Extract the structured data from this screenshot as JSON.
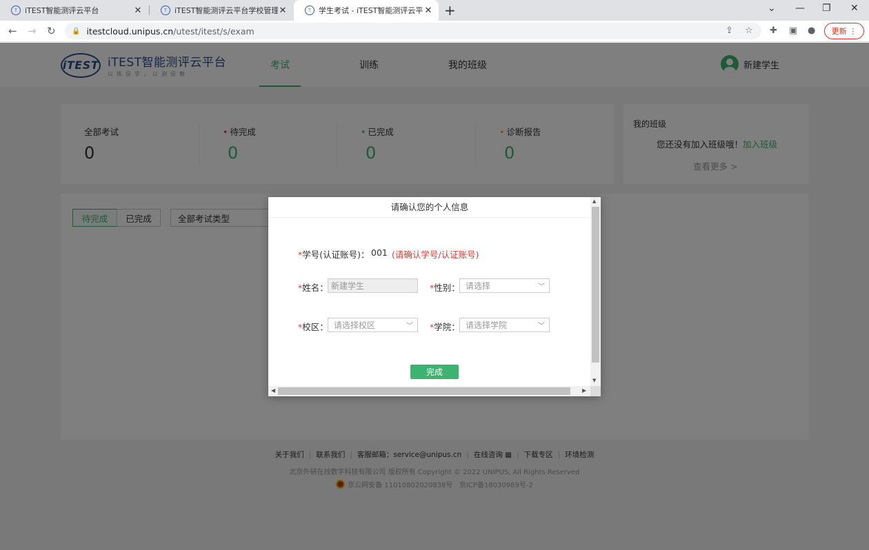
{
  "browser": {
    "tabs": [
      {
        "title": "iTEST智能测评云平台"
      },
      {
        "title": "iTEST智能测评云平台学校管理员"
      },
      {
        "title": "学生考试 - iTEST智能测评云平台"
      }
    ],
    "url_host": "itestcloud.unipus.cn",
    "url_path": "/utest/itest/s/exam",
    "update_label": "更新"
  },
  "header": {
    "logo_mark": "iTEST",
    "logo_title": "iTEST智能测评云平台",
    "logo_sub": "以练促学，以测促教",
    "nav": [
      "考试",
      "训练",
      "我的班级"
    ],
    "user_name": "新建学生"
  },
  "stats": [
    {
      "label": "全部考试",
      "value": "0"
    },
    {
      "label": "待完成",
      "value": "0"
    },
    {
      "label": "已完成",
      "value": "0"
    },
    {
      "label": "诊断报告",
      "value": "0"
    }
  ],
  "my_class": {
    "title": "我的班级",
    "message": "您还没有加入班级哦！",
    "join": "加入班级",
    "more": "查看更多 >"
  },
  "filters": {
    "pending": "待完成",
    "done": "已完成",
    "type": "全部考试类型"
  },
  "footer": {
    "links": [
      "关于我们",
      "联系我们",
      "客服邮箱：service@unipus.cn",
      "在线咨询",
      "下载专区",
      "环境检测"
    ],
    "copyright": "北京外研在线数字科技有限公司 版权所有 Copyright © 2022 UNIPUS, All Rights Reserved",
    "police": "京公网安备 11010802020838号",
    "icp": "京ICP备18030989号-2"
  },
  "modal": {
    "title": "请确认您的个人信息",
    "id_label": "学号(认证账号)：",
    "id_value": "001",
    "id_hint": "(请确认学号/认证账号)",
    "name_label": "姓名：",
    "name_value": "新建学生",
    "gender_label": "性别：",
    "gender_placeholder": "请选择",
    "campus_label": "校区：",
    "campus_placeholder": "请选择校区",
    "college_label": "学院：",
    "college_placeholder": "请选择学院",
    "submit": "完成"
  }
}
